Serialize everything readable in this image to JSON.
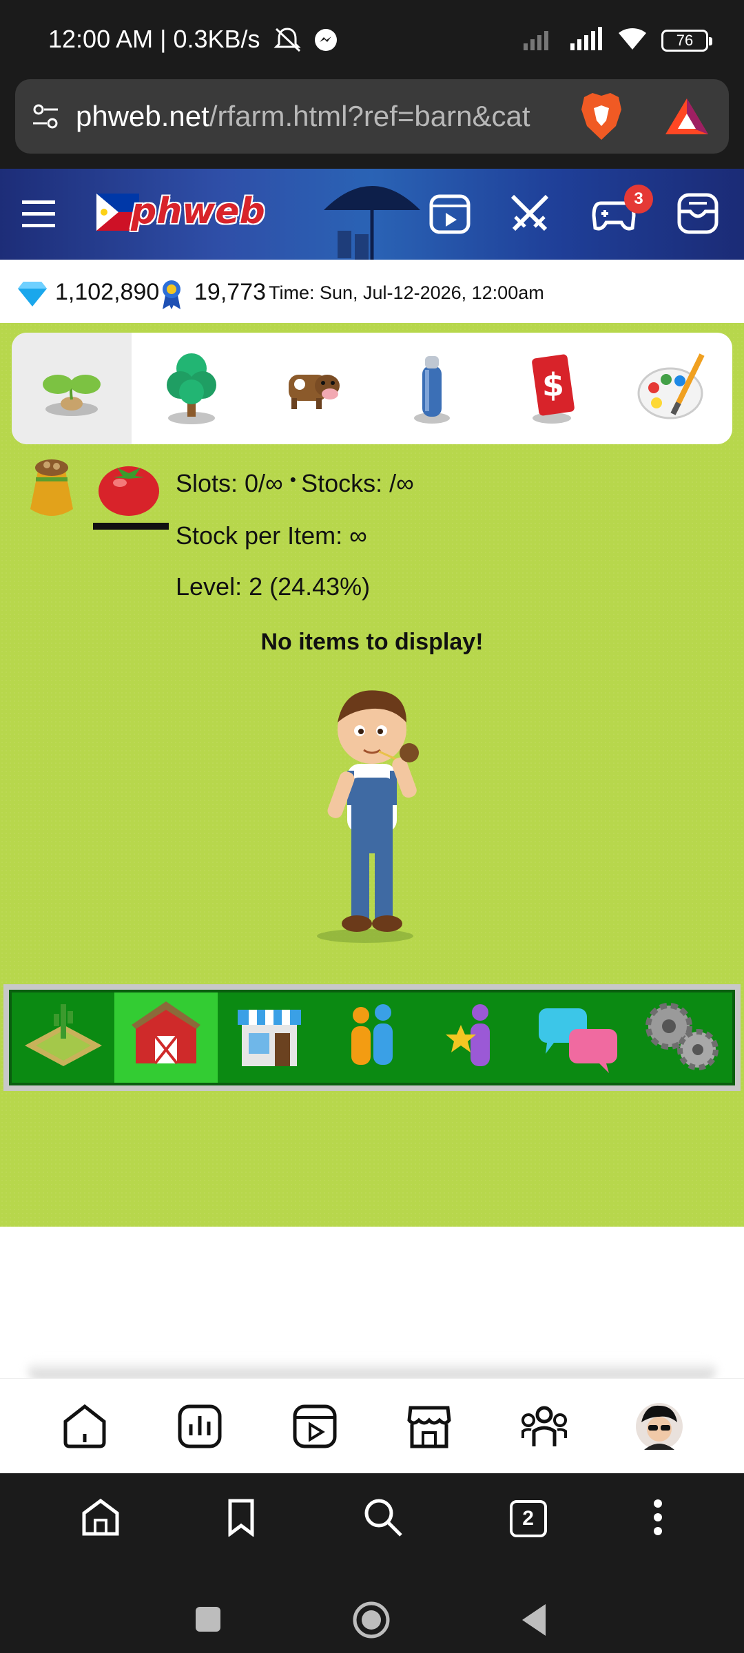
{
  "status_bar": {
    "time_speed": "12:00 AM | 0.3KB/s",
    "battery": "76"
  },
  "browser": {
    "url_host": "phweb.net",
    "url_path": "/rfarm.html?ref=barn&cat",
    "tab_count": "2"
  },
  "site": {
    "logo": "phweb",
    "notification_count": "3"
  },
  "info": {
    "diamonds": "1,102,890",
    "ribbons": "19,773",
    "time": "Time: Sun, Jul-12-2026, 12:00am"
  },
  "category_tabs": [
    {
      "icon": "sprout-icon"
    },
    {
      "icon": "tree-icon"
    },
    {
      "icon": "cow-icon"
    },
    {
      "icon": "spray-can-icon"
    },
    {
      "icon": "money-card-icon"
    },
    {
      "icon": "palette-icon"
    }
  ],
  "stats": {
    "slots": "Slots: 0/∞",
    "stocks": "Stocks: /∞",
    "stock_per_item": "Stock per Item: ∞",
    "level": "Level: 2 (24.43%)"
  },
  "empty_message": "No items to display!",
  "farm_nav": [
    {
      "icon": "farm-field-icon"
    },
    {
      "icon": "barn-icon"
    },
    {
      "icon": "shop-icon"
    },
    {
      "icon": "friends-icon"
    },
    {
      "icon": "star-user-icon"
    },
    {
      "icon": "chat-bubbles-icon"
    },
    {
      "icon": "gears-icon"
    }
  ],
  "colors": {
    "grass": "#b7d74c",
    "nav_green": "#0b8a12",
    "nav_active": "#33cc33",
    "badge_red": "#e53935"
  }
}
